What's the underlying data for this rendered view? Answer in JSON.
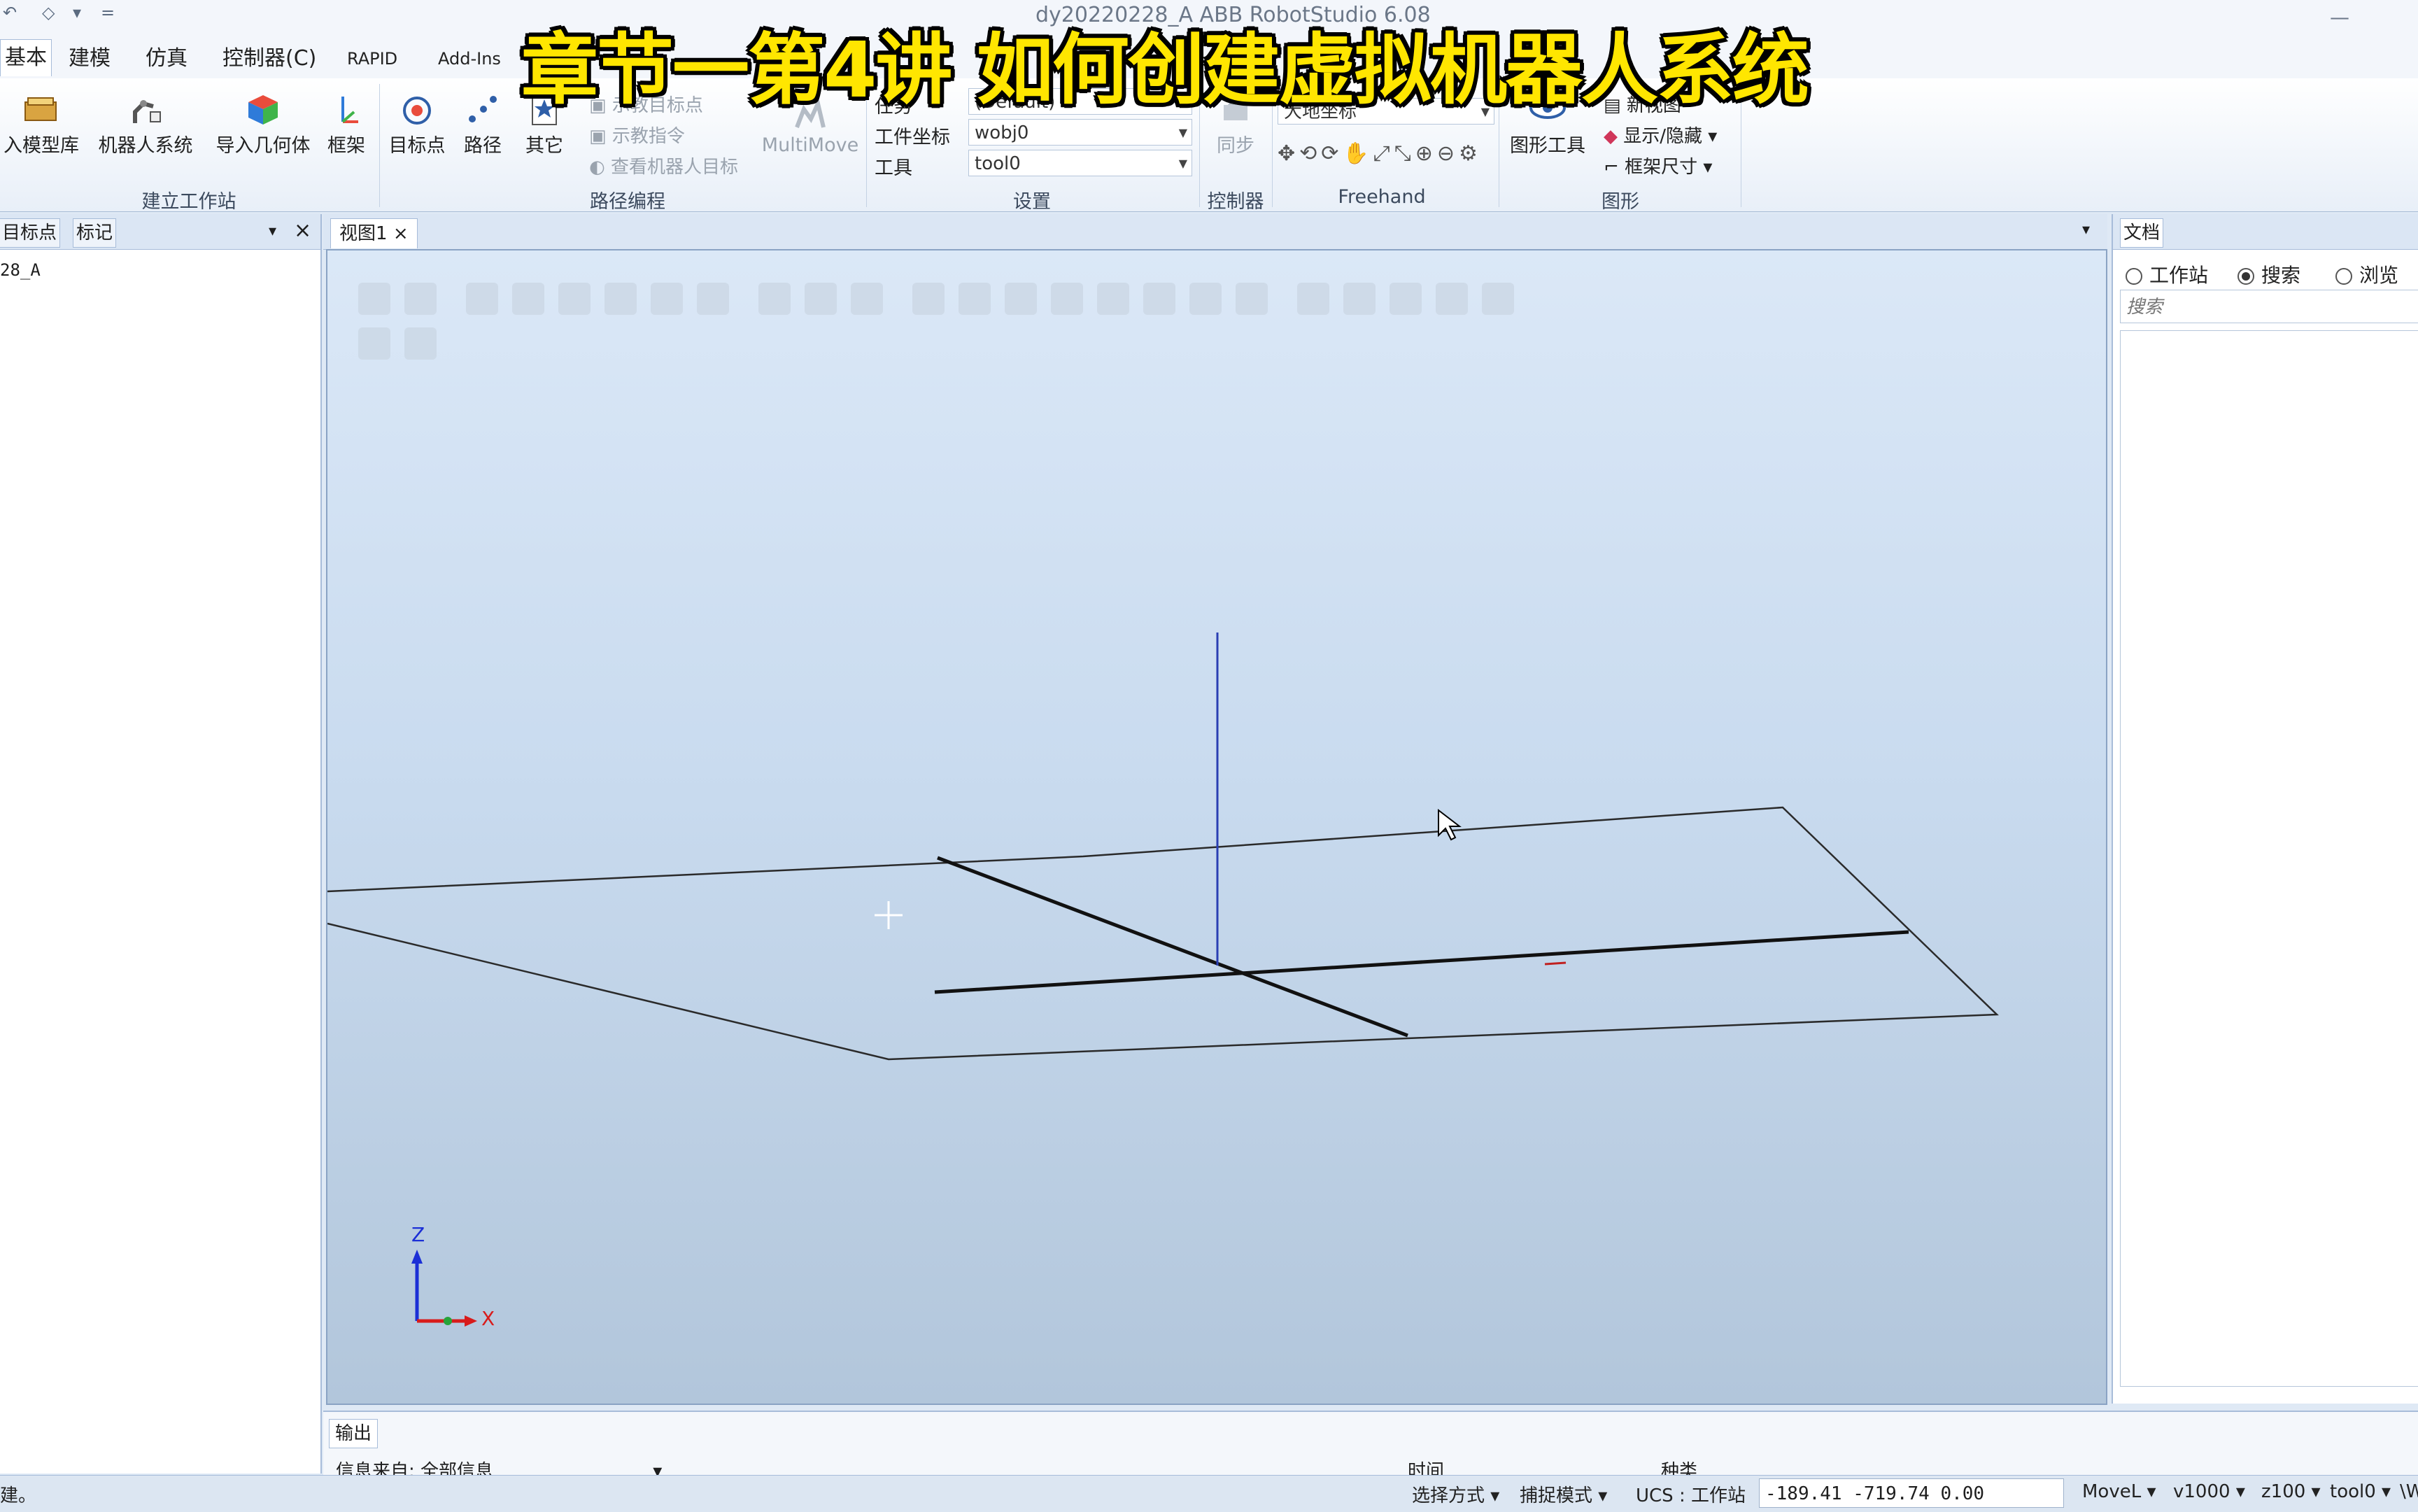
{
  "overlay_title": "章节一第4讲 如何创建虚拟机器人系统",
  "window": {
    "title_fragment": "dy20220228_A  ABB RobotStudio 6.08",
    "quick_access": [
      "↶",
      "◇",
      "▾",
      "="
    ],
    "minimize": "—"
  },
  "tabs": [
    {
      "label": "基本",
      "active": true
    },
    {
      "label": "建模"
    },
    {
      "label": "仿真"
    },
    {
      "label": "控制器(C)"
    },
    {
      "label": "RAPID"
    },
    {
      "label": "Add-Ins"
    }
  ],
  "ribbon": {
    "build_station": {
      "label": "建立工作站",
      "buttons": [
        "入模型库",
        "机器人系统",
        "导入几何体",
        "框架"
      ]
    },
    "path_programming": {
      "label": "路径编程",
      "buttons": [
        "目标点",
        "路径",
        "其它"
      ],
      "small": [
        "示教目标点",
        "示教指令",
        "查看机器人目标"
      ],
      "multimove": "MultiMove"
    },
    "settings": {
      "label": "设置",
      "fields": [
        {
          "label": "任务",
          "value": "(Default)"
        },
        {
          "label": "工件坐标",
          "value": "wobj0"
        },
        {
          "label": "工具",
          "value": "tool0"
        }
      ]
    },
    "controller": {
      "label": "控制器",
      "sync": "同步"
    },
    "freehand": {
      "label": "Freehand",
      "frame": "大地坐标"
    },
    "graphics": {
      "label": "图形",
      "tool_button": "图形工具",
      "items": [
        "新视图",
        "显示/隐藏",
        "框架尺寸"
      ]
    }
  },
  "left_panel": {
    "tabs": [
      "目标点",
      "标记"
    ],
    "items": [
      "28_A"
    ]
  },
  "viewport": {
    "tab_label": "视图1",
    "axis_labels": {
      "z": "Z",
      "x": "X"
    }
  },
  "right_panel": {
    "tab_label": "文档",
    "radios": [
      {
        "label": "工作站",
        "selected": false
      },
      {
        "label": "搜索",
        "selected": true
      },
      {
        "label": "浏览",
        "selected": false
      }
    ],
    "search_placeholder": "搜索"
  },
  "output": {
    "tab_label": "输出",
    "filter_text": "信息来自: 全部信息",
    "columns": [
      "时间",
      "种类"
    ]
  },
  "status": {
    "left_text": "建。",
    "selection_mode": "选择方式",
    "snap_mode": "捕捉模式",
    "ucs": "UCS : 工作站",
    "coords": "-189.41   -719.74   0.00",
    "move_type": "MoveL",
    "speed": "v1000",
    "zone": "z100",
    "tool": "tool0",
    "tail": "\\W"
  },
  "colors": {
    "overlay_text": "#ffe600",
    "accent": "#1a5fb4"
  }
}
